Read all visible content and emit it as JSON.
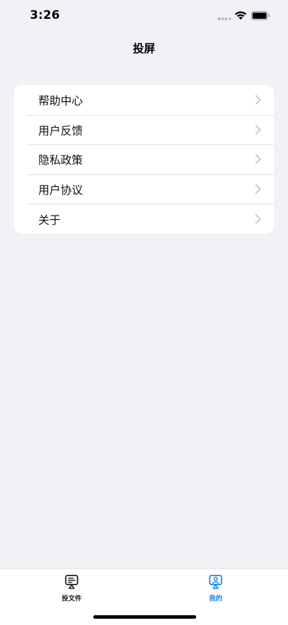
{
  "status_bar": {
    "time": "3:26",
    "icons": [
      "signal-dots-icon",
      "wifi-icon",
      "battery-icon"
    ]
  },
  "header": {
    "title": "投屏"
  },
  "menu": {
    "items": [
      {
        "label": "帮助中心",
        "icon": "chevron-right-icon"
      },
      {
        "label": "用户反馈",
        "icon": "chevron-right-icon"
      },
      {
        "label": "隐私政策",
        "icon": "chevron-right-icon"
      },
      {
        "label": "用户协议",
        "icon": "chevron-right-icon"
      },
      {
        "label": "关于",
        "icon": "chevron-right-icon"
      }
    ]
  },
  "tab_bar": {
    "tabs": [
      {
        "label": "投文件",
        "icon": "cast-file-icon",
        "active": false
      },
      {
        "label": "我的",
        "icon": "profile-cast-icon",
        "active": true
      }
    ]
  },
  "colors": {
    "background": "#f2f1f6",
    "card": "#ffffff",
    "active_tab": "#1a86e6",
    "inactive_tab": "#1c1c1e",
    "chevron": "#c4c4c8"
  }
}
